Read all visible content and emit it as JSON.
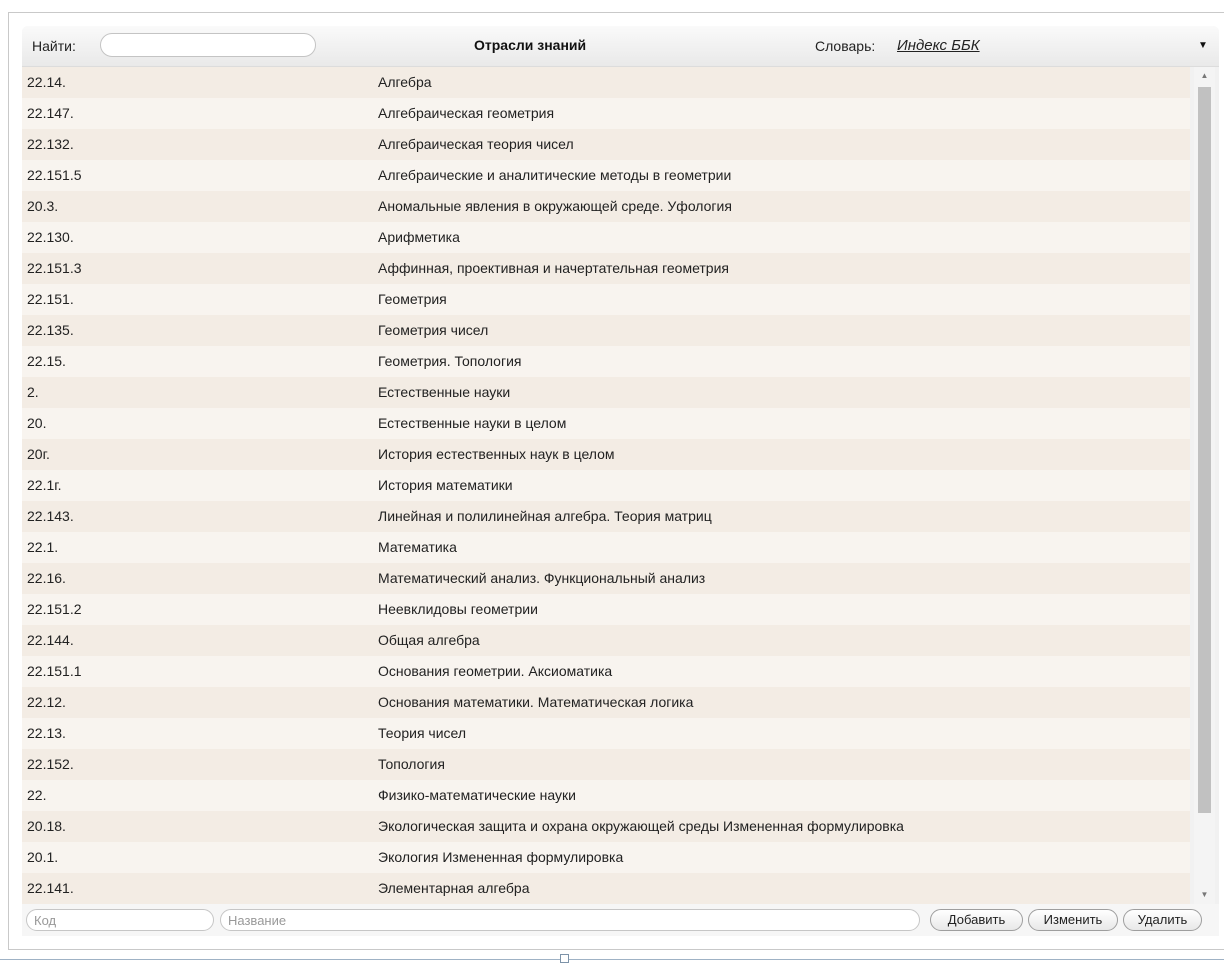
{
  "header": {
    "find_label": "Найти:",
    "find_value": "",
    "title": "Отрасли знаний",
    "dict_label": "Словарь:",
    "dict_value": "Индекс ББК",
    "dropdown_icon": "triangle-down-icon"
  },
  "rows": [
    {
      "code": "22.14.",
      "name": "Алгебра"
    },
    {
      "code": "22.147.",
      "name": "Алгебраическая геометрия"
    },
    {
      "code": "22.132.",
      "name": "Алгебраическая теория чисел"
    },
    {
      "code": "22.151.5",
      "name": "Алгебраические и аналитические методы в геометрии"
    },
    {
      "code": "20.3.",
      "name": "Аномальные явления в окружающей среде. Уфология"
    },
    {
      "code": "22.130.",
      "name": "Арифметика"
    },
    {
      "code": "22.151.3",
      "name": "Аффинная, проективная и начертательная геометрия"
    },
    {
      "code": "22.151.",
      "name": "Геометрия"
    },
    {
      "code": "22.135.",
      "name": "Геометрия чисел"
    },
    {
      "code": "22.15.",
      "name": "Геометрия. Топология"
    },
    {
      "code": "2.",
      "name": "Естественные науки"
    },
    {
      "code": "20.",
      "name": "Естественные науки в целом"
    },
    {
      "code": "20г.",
      "name": "История естественных наук в целом"
    },
    {
      "code": "22.1г.",
      "name": "История математики"
    },
    {
      "code": "22.143.",
      "name": "Линейная и полилинейная алгебра. Теория матриц"
    },
    {
      "code": "22.1.",
      "name": "Математика"
    },
    {
      "code": "22.16.",
      "name": "Математический анализ. Функциональный анализ"
    },
    {
      "code": "22.151.2",
      "name": "Неевклидовы геометрии"
    },
    {
      "code": "22.144.",
      "name": "Общая алгебра"
    },
    {
      "code": "22.151.1",
      "name": "Основания геометрии. Аксиоматика"
    },
    {
      "code": "22.12.",
      "name": "Основания математики. Математическая логика"
    },
    {
      "code": "22.13.",
      "name": "Теория чисел"
    },
    {
      "code": "22.152.",
      "name": "Топология"
    },
    {
      "code": "22.",
      "name": "Физико-математические науки"
    },
    {
      "code": "20.18.",
      "name": "Экологическая защита и охрана окружающей среды Измененная формулировка"
    },
    {
      "code": "20.1.",
      "name": "Экология Измененная формулировка"
    },
    {
      "code": "22.141.",
      "name": "Элементарная алгебра"
    }
  ],
  "footer": {
    "code_placeholder": "Код",
    "name_placeholder": "Название",
    "add_label": "Добавить",
    "edit_label": "Изменить",
    "delete_label": "Удалить"
  },
  "colors": {
    "row_odd": "#f3ece4",
    "row_even": "#f8f4ef",
    "scroll_thumb": "#c1c1c1"
  }
}
